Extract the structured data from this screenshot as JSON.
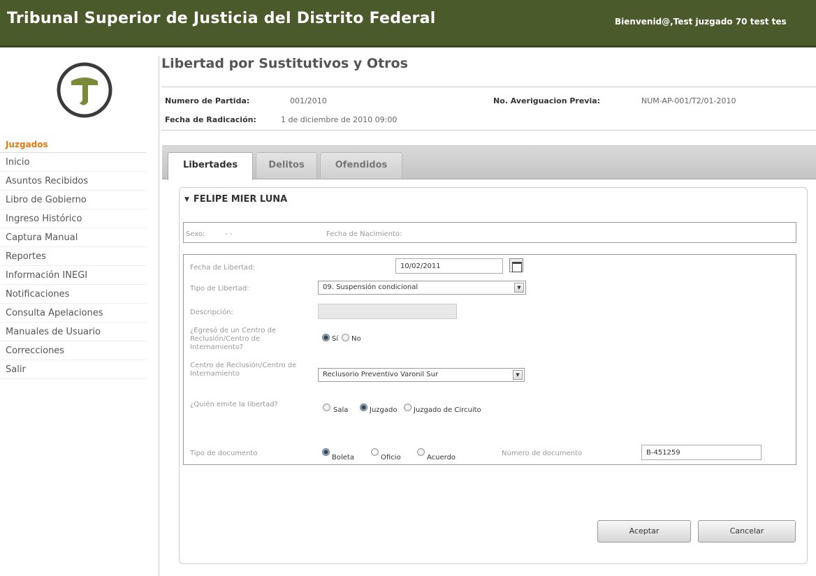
{
  "header": {
    "title": "Tribunal Superior de Justicia del Distrito Federal",
    "welcome": "Bienvenid@,Test juzgado 70 test tes"
  },
  "sidebar": {
    "section": "Juzgados",
    "items": [
      {
        "label": "Inicio"
      },
      {
        "label": "Asuntos Recibidos"
      },
      {
        "label": "Libro de Gobierno"
      },
      {
        "label": "Ingreso Histórico"
      },
      {
        "label": "Captura Manual"
      },
      {
        "label": "Reportes"
      },
      {
        "label": "Información INEGI"
      },
      {
        "label": "Notificaciones"
      },
      {
        "label": "Consulta Apelaciones"
      },
      {
        "label": "Manuales de Usuario"
      },
      {
        "label": "Correcciones"
      },
      {
        "label": "Salir"
      }
    ]
  },
  "page": {
    "title": "Libertad por Sustitutivos y Otros",
    "numero_partida_label": "Numero de Partida:",
    "numero_partida_value": "001/2010",
    "averiguacion_label": "No. Averiguacion Previa:",
    "averiguacion_value": "NUM-AP-001/T2/01-2010",
    "fecha_radicacion_label": "Fecha de Radicación:",
    "fecha_radicacion_value": "1 de diciembre de 2010 09:00"
  },
  "tabs": [
    {
      "label": "Libertades",
      "active": true
    },
    {
      "label": "Delitos",
      "active": false
    },
    {
      "label": "Ofendidos",
      "active": false
    }
  ],
  "person": {
    "name": "FELIPE MIER LUNA",
    "sexo_label": "Sexo:",
    "sexo_value": "- -",
    "nacimiento_label": "Fecha de Nacimiento:"
  },
  "form": {
    "fecha_libertad_label": "Fecha de Libertad:",
    "fecha_libertad_value": "10/02/2011",
    "tipo_libertad_label": "Tipo de Libertad:",
    "tipo_libertad_value": "09. Suspensión condicional",
    "descripcion_label": "Descripción:",
    "egreso_label": "¿Egresó de un Centro de Reclusión/Centro de Internamiento?",
    "egreso_options": [
      "Sí",
      "No"
    ],
    "egreso_selected": "Sí",
    "centro_label": "Centro de Reclusión/Centro de Internamiento",
    "centro_value": "Reclusorio Preventivo Varonil Sur",
    "quien_label": "¿Quién emite la libertad?",
    "quien_options": [
      "Sala",
      "Juzgado",
      "Juzgado de Circuito"
    ],
    "quien_selected": "Juzgado",
    "tipo_doc_label": "Tipo de documento",
    "tipo_doc_options": [
      "Boleta",
      "Oficio",
      "Acuerdo"
    ],
    "tipo_doc_selected": "Boleta",
    "numero_doc_label": "Número de documento",
    "numero_doc_value": "B-451259"
  },
  "buttons": {
    "accept": "Aceptar",
    "cancel": "Cancelar"
  },
  "colors": {
    "header_bg": "#4b5a2a",
    "section_accent": "#e07a10"
  }
}
